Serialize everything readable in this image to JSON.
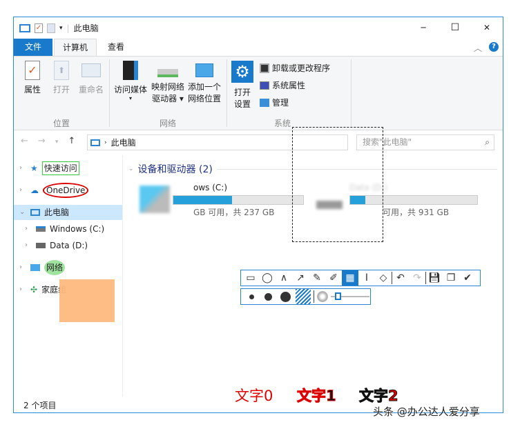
{
  "title": "此电脑",
  "window_controls": {
    "minimize": "─",
    "maximize": "☐",
    "close": "✕"
  },
  "menu": {
    "file": "文件",
    "computer": "计算机",
    "view": "查看"
  },
  "ribbon": {
    "location": {
      "label": "位置",
      "properties": "属性",
      "open": "打开",
      "rename": "重命名"
    },
    "network": {
      "label": "网络",
      "media": "访问媒体",
      "map_drive_1": "映射网络",
      "map_drive_2": "驱动器",
      "add_location_1": "添加一个",
      "add_location_2": "网络位置"
    },
    "system": {
      "label": "系统",
      "open_settings_1": "打开",
      "open_settings_2": "设置",
      "uninstall": "卸载或更改程序",
      "system_props": "系统属性",
      "manage": "管理"
    }
  },
  "address": {
    "path": "此电脑",
    "search_placeholder": "搜索\"此电脑\""
  },
  "nav": {
    "items": [
      {
        "label": "快速访问"
      },
      {
        "label": "OneDrive"
      },
      {
        "label": "此电脑"
      },
      {
        "label": "Windows (C:)"
      },
      {
        "label": "Data (D:)"
      },
      {
        "label": "网络"
      },
      {
        "label": "家庭组"
      }
    ]
  },
  "content": {
    "group_title": "设备和驱动器 (2)",
    "drives": [
      {
        "name": "Windows (C:)",
        "visible_name": "ows (C:)",
        "free_text": "GB 可用，共 237 GB",
        "usage": 0.45
      },
      {
        "name": "Data (D:)",
        "free_text": "可用，共 931 GB",
        "usage": 0.12
      }
    ]
  },
  "annotations": {
    "text0": "文字0",
    "text1": "文字1",
    "text2": "文字2"
  },
  "status": {
    "count": "2 个项目"
  },
  "watermark": "头条 @办公达人爱分享",
  "colors": {
    "accent": "#1979ca",
    "red": "#e00000"
  }
}
